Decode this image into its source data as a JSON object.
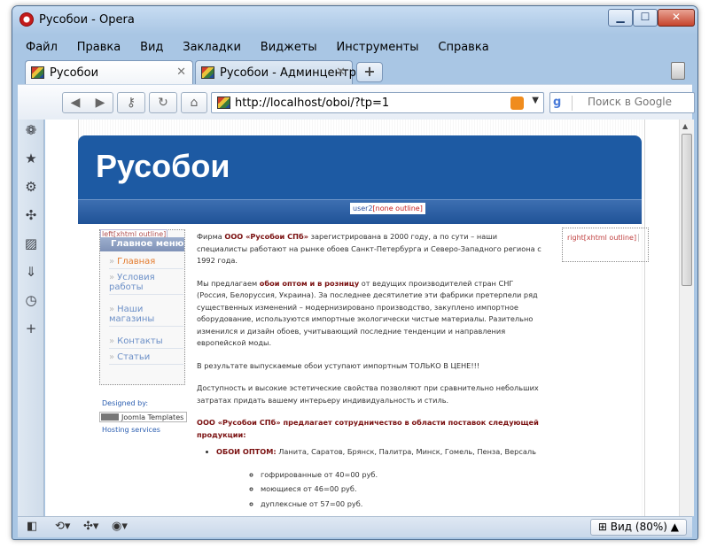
{
  "window": {
    "title": "Русобои - Opera",
    "min_label": "▁",
    "max_label": "☐",
    "close_label": "✕"
  },
  "menu": [
    "Файл",
    "Правка",
    "Вид",
    "Закладки",
    "Виджеты",
    "Инструменты",
    "Справка"
  ],
  "tabs": [
    {
      "label": "Русобои",
      "close": "✕"
    },
    {
      "label": "Русобои - Админцентр",
      "close": "✕"
    }
  ],
  "new_tab_label": "+",
  "nav": {
    "back_icon": "◀",
    "forward_icon": "▶",
    "key_icon": "⚷",
    "reload_icon": "↻",
    "home_icon": "⌂",
    "url": "http://localhost/oboi/?tp=1",
    "search_placeholder": "Поиск в Google"
  },
  "status": {
    "zoom_label": "Вид (80%)"
  },
  "page": {
    "site_title": "Русобои",
    "user_badge": "user2",
    "user_badge_suffix": "[none outline]",
    "left_label": "left",
    "left_label_suffix": "[xhtml outline]",
    "menu_heading": "Главное меню",
    "menu_items": [
      {
        "label": "Главная",
        "active": true
      },
      {
        "label": "Условия работы",
        "active": false
      },
      {
        "label": "Наши магазины",
        "active": false
      },
      {
        "label": "Контакты",
        "active": false
      },
      {
        "label": "Статьи",
        "active": false
      }
    ],
    "designed_by": "Designed by:",
    "joomla_templates": "Joomla Templates",
    "hosting": "Hosting services",
    "right_label": "right",
    "right_label_suffix": "[xhtml outline]",
    "paragraphs": [
      {
        "pre": "Фирма ",
        "hl": "ООО «Русобои СПб»",
        "post": " зарегистрирована в 2000 году, а по сути – наши специалисты работают на рынке обоев Санкт-Петербурга и Северо-Западного региона с 1992 года."
      },
      {
        "pre": "Мы предлагаем ",
        "hl": "обои оптом и в розницу",
        "post": " от ведущих производителей стран СНГ (Россия, Белоруссия, Украина). За последнее десятилетие эти фабрики претерпели ряд существенных изменений – модернизировано производство, закуплено импортное оборудование, используются импортные экологически чистые материалы. Разительно изменился и дизайн обоев, учитывающий последние тенденции и направления европейской моды."
      },
      {
        "pre": "В результате выпускаемые обои уступают импортным ТОЛЬКО В ЦЕНЕ!!!",
        "hl": "",
        "post": ""
      },
      {
        "pre": "Доступность и высокие эстетические свойства позволяют при сравнительно небольших затратах придать вашему интерьеру индивидуальность и стиль.",
        "hl": "",
        "post": ""
      },
      {
        "pre": "",
        "hl": "ООО «Русобои СПб» предлагает сотрудничество в области поставок следующей продукции:",
        "post": ""
      }
    ],
    "bullet": {
      "hl": "ОБОИ ОПТОМ:",
      "text": " Ланита, Саратов, Брянск, Палитра, Минск, Гомель, Пенза, Версаль"
    },
    "sub_bullets": [
      "гофрированные от 40=00 руб.",
      "моющиеся от 46=00 руб.",
      "дуплексные от 57=00 руб."
    ]
  },
  "colors": {
    "header_blue": "#1d5aa3",
    "accent_red": "#7a1010",
    "link_blue": "#6b8fc7",
    "active_orange": "#e37a2c"
  }
}
